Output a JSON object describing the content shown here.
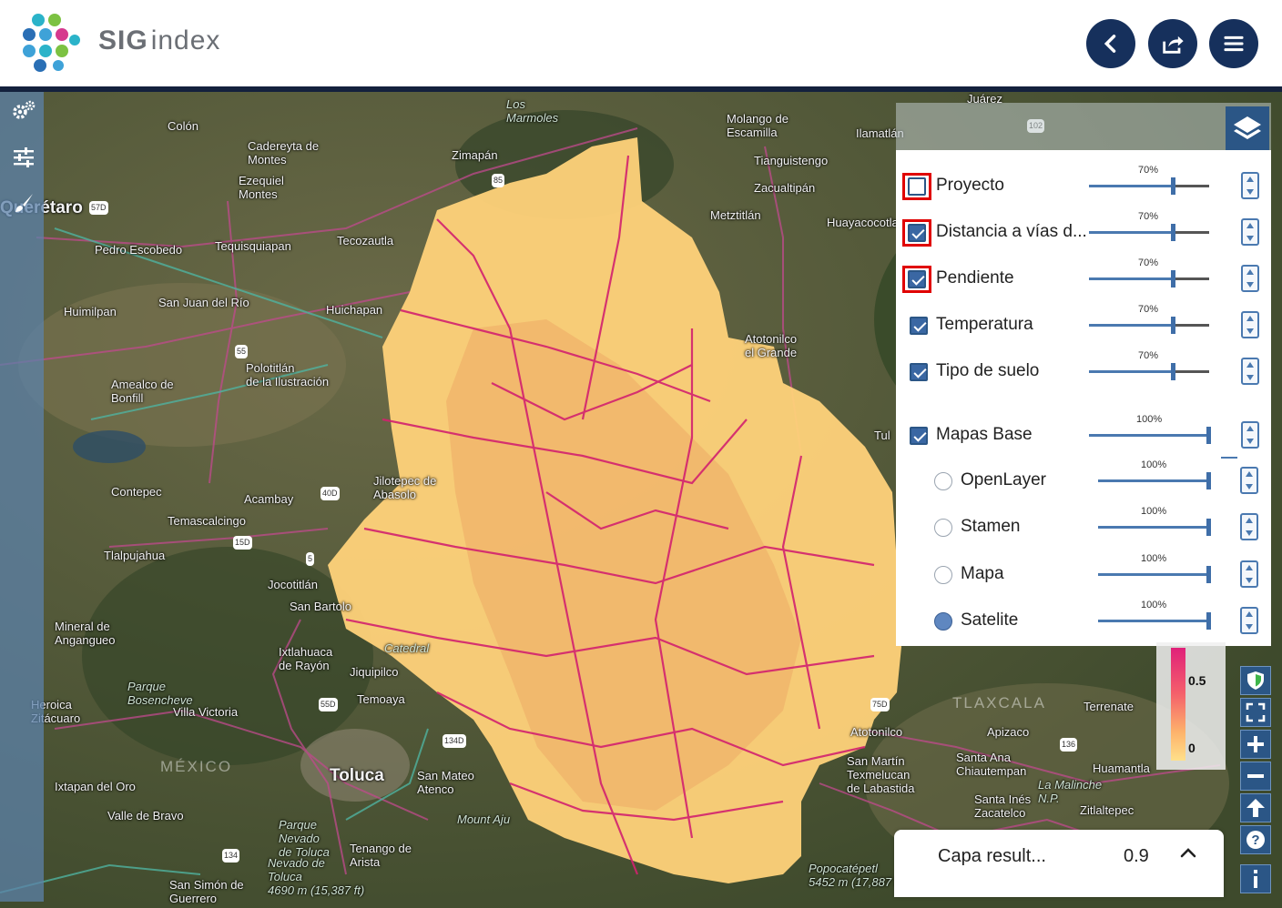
{
  "header": {
    "brand_a": "SIG",
    "brand_b": "index",
    "buttons": [
      {
        "name": "back-button",
        "icon": "chevron-left-icon"
      },
      {
        "name": "share-button",
        "icon": "share-icon"
      },
      {
        "name": "menu-button",
        "icon": "hamburger-icon"
      }
    ],
    "colors": {
      "button_bg": "#16305c",
      "rule": "#14213d",
      "brand_text": "#6b6f75"
    }
  },
  "map": {
    "places": [
      "Colón",
      "Cadereyta de\nMontes",
      "Ezequiel\nMontes",
      "Querétaro",
      "Pedro Escobedo",
      "Tequisquiapan",
      "Tecozautla",
      "San Juan del Río",
      "Huimilpan",
      "Huichapan",
      "Polotitlán\nde la Ilustración",
      "Amealco de\nBonfill",
      "Zimapán",
      "Molango de\nEscamilla",
      "Ilamatlán",
      "Tianguistengo",
      "Zacualtipán",
      "Metztitlán",
      "Huayacocotla",
      "Atotonilco\nel Grande",
      "Contepec",
      "Acambay",
      "Jilotepec de\nAbasolo",
      "Temascalcingo",
      "Tlalpujahua",
      "Jocotitlán",
      "San Bartolo",
      "Mineral de\nAngangueo",
      "Ixtlahuaca\nde Rayón",
      "Jiquipilco",
      "Temoaya",
      "Villa Victoria",
      "Heroica\nZitácuaro",
      "Toluca",
      "San Mateo\nAtenco",
      "Ixtapan del Oro",
      "Valle de Bravo",
      "Tenango de\nArista",
      "San Simón de\nGuerrero",
      "Atotonilco",
      "San Martín\nTexmelucan\nde Labastida",
      "Santa Ana\nChiautempan",
      "Apizaco",
      "Terrenate",
      "Huamantla",
      "Santa Inés\nZacatelco",
      "Zitlaltepec",
      "Juárez",
      "Tul"
    ],
    "italic_places": [
      "Los\nMarmoles",
      "Parque\nBosencheve",
      "Parque\nNevado\nde Toluca",
      "Nevado de\nToluca\n4690 m (15,387 ft)",
      "Popocatépetl\n5452 m (17,887 ft)",
      "La Malinche\nN.P.",
      "Mount Aju",
      "Catedral"
    ],
    "states": [
      "MÉXICO",
      "TLAXCALA"
    ],
    "route_shields": [
      "57D",
      "85",
      "55",
      "40D",
      "15D",
      "5",
      "55D",
      "134D",
      "134",
      "75D",
      "136",
      "102"
    ]
  },
  "toolbar": {
    "tools": [
      {
        "name": "settings-gears-button",
        "icon": "gears-icon"
      },
      {
        "name": "filters-button",
        "icon": "sliders-icon"
      },
      {
        "name": "draw-button",
        "icon": "brush-icon"
      }
    ]
  },
  "layers": {
    "toggle_icon": "layers-icon",
    "items": [
      {
        "label": "Proyecto",
        "checked": false,
        "highlight": true,
        "opacity": "70%"
      },
      {
        "label": "Distancia a vías d...",
        "checked": true,
        "highlight": true,
        "opacity": "70%"
      },
      {
        "label": "Pendiente",
        "checked": true,
        "highlight": true,
        "opacity": "70%"
      },
      {
        "label": "Temperatura",
        "checked": true,
        "highlight": false,
        "opacity": "70%"
      },
      {
        "label": "Tipo de suelo",
        "checked": true,
        "highlight": false,
        "opacity": "70%"
      }
    ],
    "base": {
      "label": "Mapas Base",
      "checked": true,
      "opacity": "100%"
    },
    "base_options": [
      {
        "label": "OpenLayer",
        "selected": false,
        "opacity": "100%"
      },
      {
        "label": "Stamen",
        "selected": false,
        "opacity": "100%"
      },
      {
        "label": "Mapa",
        "selected": false,
        "opacity": "100%"
      },
      {
        "label": "Satelite",
        "selected": true,
        "opacity": "100%"
      }
    ],
    "colors": {
      "accent": "#4a79b0",
      "highlight": "#e00000"
    }
  },
  "legend": {
    "labels": [
      "0.5",
      "0"
    ],
    "colors": [
      "#e0207a",
      "#f45f6b",
      "#fdb36b",
      "#ffe08a"
    ]
  },
  "controls": [
    {
      "name": "shield-button",
      "icon": "shield-icon"
    },
    {
      "name": "fullscreen-button",
      "icon": "fullscreen-icon"
    },
    {
      "name": "zoom-in-button",
      "icon": "plus-icon"
    },
    {
      "name": "zoom-out-button",
      "icon": "minus-icon"
    },
    {
      "name": "north-button",
      "icon": "arrow-up-icon"
    },
    {
      "name": "help-button",
      "icon": "question-icon"
    },
    {
      "name": "info-button",
      "icon": "info-icon"
    }
  ],
  "result": {
    "label": "Capa result...",
    "value": "0.9",
    "icon": "chevron-up-icon"
  }
}
